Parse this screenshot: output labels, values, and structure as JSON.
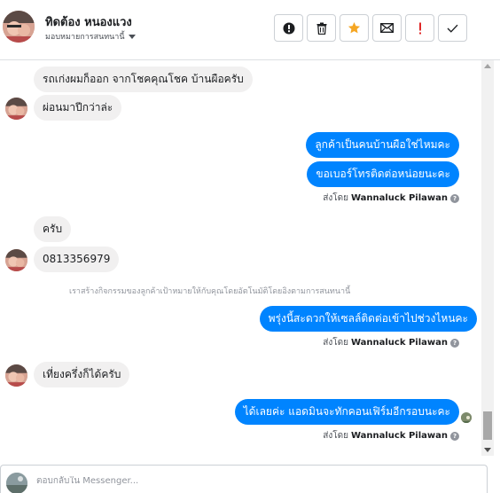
{
  "header": {
    "name": "ทิดต้อง หนองแวง",
    "subtitle": "มอบหมายการสนทนานี้",
    "buttons": [
      {
        "name": "mark-spam-button",
        "icon": "exclamation-circle-icon"
      },
      {
        "name": "delete-button",
        "icon": "trash-icon"
      },
      {
        "name": "star-button",
        "icon": "star-icon"
      },
      {
        "name": "mark-unread-button",
        "icon": "envelope-icon"
      },
      {
        "name": "follow-up-button",
        "icon": "exclamation-icon"
      },
      {
        "name": "mark-done-button",
        "icon": "check-icon"
      }
    ]
  },
  "messages": {
    "m1": "รถเก่งผมก็ออก จากโชคคุณโชค บ้านผือครับ",
    "m2": "ผ่อนมาปีกว่าล่ะ",
    "m3": "ลูกค้าเป็นคนบ้านผือใช่ไหมคะ",
    "m4": "ขอเบอร์โทรติดต่อหน่อยนะคะ",
    "m5": "ครับ",
    "m6": "0813356979",
    "m7": "พรุ่งนี้สะดวกให้เซลล์ติดต่อเข้าไปช่วงไหนคะ",
    "m8": "เที่ยงครึ่งก็ได้ครับ",
    "m9": "ได้เลยค่ะ แอดมินจะทักคอนเฟิร์มอีกรอบนะคะ"
  },
  "sent_by": {
    "prefix": "ส่งโดย",
    "sender": "Wannaluck Pilawan",
    "help": "?"
  },
  "system_note": "เราสร้างกิจกรรมของลูกค้าเป้าหมายให้กับคุณโดยอัตโนมัติโดยอิงตามการสนทนานี้",
  "composer": {
    "placeholder": "ตอบกลับใน Messenger..."
  },
  "colors": {
    "outgoing": "#0084ff",
    "incoming": "#f1f0f0",
    "star": "#f5a623",
    "alert": "#e02828"
  }
}
